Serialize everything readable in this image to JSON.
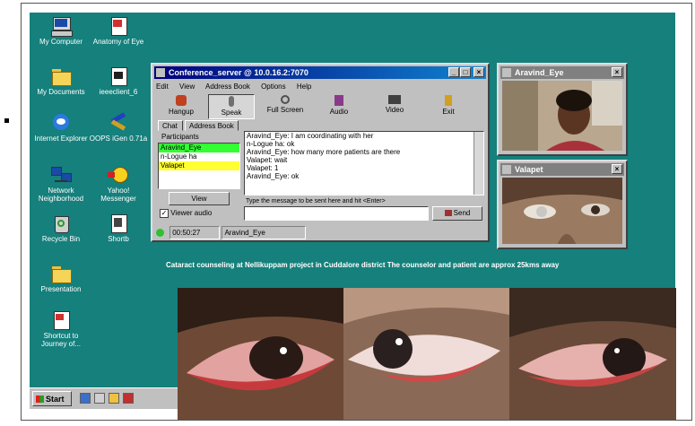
{
  "desktop_icons_left": [
    {
      "label": "My Computer",
      "icon": "computer-icon"
    },
    {
      "label": "My Documents",
      "icon": "folder-icon"
    },
    {
      "label": "Internet Explorer",
      "icon": "ie-icon"
    },
    {
      "label": "Network Neighborhood",
      "icon": "network-icon"
    },
    {
      "label": "Recycle Bin",
      "icon": "recycle-bin-icon"
    },
    {
      "label": "Presentation",
      "icon": "folder-icon"
    },
    {
      "label": "Shortcut to Journey of...",
      "icon": "shortcut-icon"
    }
  ],
  "desktop_icons_right": [
    {
      "label": "Anatomy of Eye",
      "icon": "document-icon"
    },
    {
      "label": "ieeeclient_6",
      "icon": "program-icon"
    },
    {
      "label": "OOPS iGen 0.71a",
      "icon": "tools-icon"
    },
    {
      "label": "Yahoo! Messenger",
      "icon": "smiley-icon"
    },
    {
      "label": "Shortb",
      "icon": "program-icon"
    }
  ],
  "taskbar": {
    "start_label": "Start"
  },
  "conference_window": {
    "title": "Conference_server @ 10.0.16.2:7070",
    "menu": [
      "Edit",
      "View",
      "Address Book",
      "Options",
      "Help"
    ],
    "toolbar": [
      {
        "label": "Hangup",
        "icon": "hangup-icon"
      },
      {
        "label": "Speak",
        "icon": "microphone-icon"
      },
      {
        "label": "Full Screen",
        "icon": "magnifier-icon"
      },
      {
        "label": "Audio",
        "icon": "speaker-icon"
      },
      {
        "label": "Video",
        "icon": "camera-icon"
      },
      {
        "label": "Exit",
        "icon": "exit-icon"
      }
    ],
    "tabs": [
      "Chat",
      "Address Book"
    ],
    "participants_label": "Participants",
    "participants": [
      {
        "name": "Aravind_Eye",
        "color": "#33ff33"
      },
      {
        "name": "n-Logue ha",
        "color": "#ffffff"
      },
      {
        "name": "Valapet",
        "color": "#ffff33"
      }
    ],
    "view_button": "View",
    "viewer_audio_label": "Viewer audio",
    "viewer_audio_checked": true,
    "chat_lines": [
      "Aravind_Eye: I am coordinating with her",
      "n-Logue ha: ok",
      "Aravind_Eye: how many more patients are there",
      "Valapet: wait",
      "Valapet: 1",
      "Aravind_Eye: ok"
    ],
    "message_hint": "Type the message to be sent here and hit <Enter>",
    "send_button": "Send",
    "status_time": "00:50:27",
    "status_user": "Aravind_Eye"
  },
  "video_windows": [
    {
      "title": "Aravind_Eye"
    },
    {
      "title": "Valapet"
    }
  ],
  "caption": "Cataract counseling at Nellikuppam project in Cuddalore district The counselor and patient are approx 25kms away"
}
